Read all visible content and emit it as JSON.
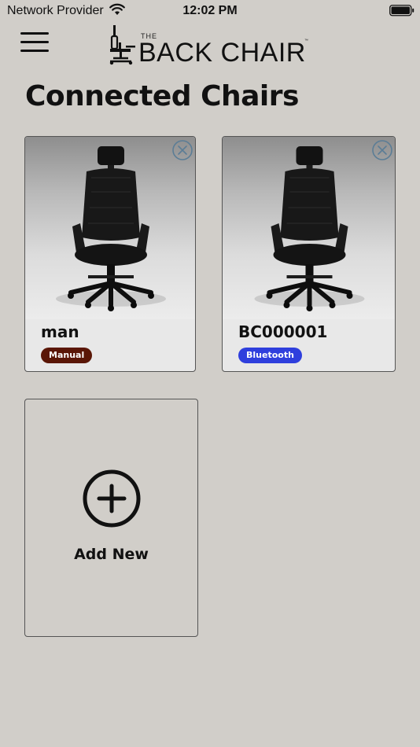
{
  "status_bar": {
    "carrier": "Network Provider",
    "time": "12:02 PM"
  },
  "header": {
    "menu_icon": "hamburger-menu-icon",
    "logo": {
      "small_text": "THE",
      "main_text": "BACK CHAIR",
      "trademark": "™"
    }
  },
  "page": {
    "title": "Connected Chairs"
  },
  "chairs": [
    {
      "name": "man",
      "type": "Manual",
      "badge_color": "#5a1606"
    },
    {
      "name": "BC000001",
      "type": "Bluetooth",
      "badge_color": "#2f3fdd"
    }
  ],
  "add_card": {
    "label": "Add New",
    "icon": "plus-circle-icon"
  },
  "colors": {
    "background": "#d1cec9",
    "remove_icon": "#5b7d96"
  }
}
